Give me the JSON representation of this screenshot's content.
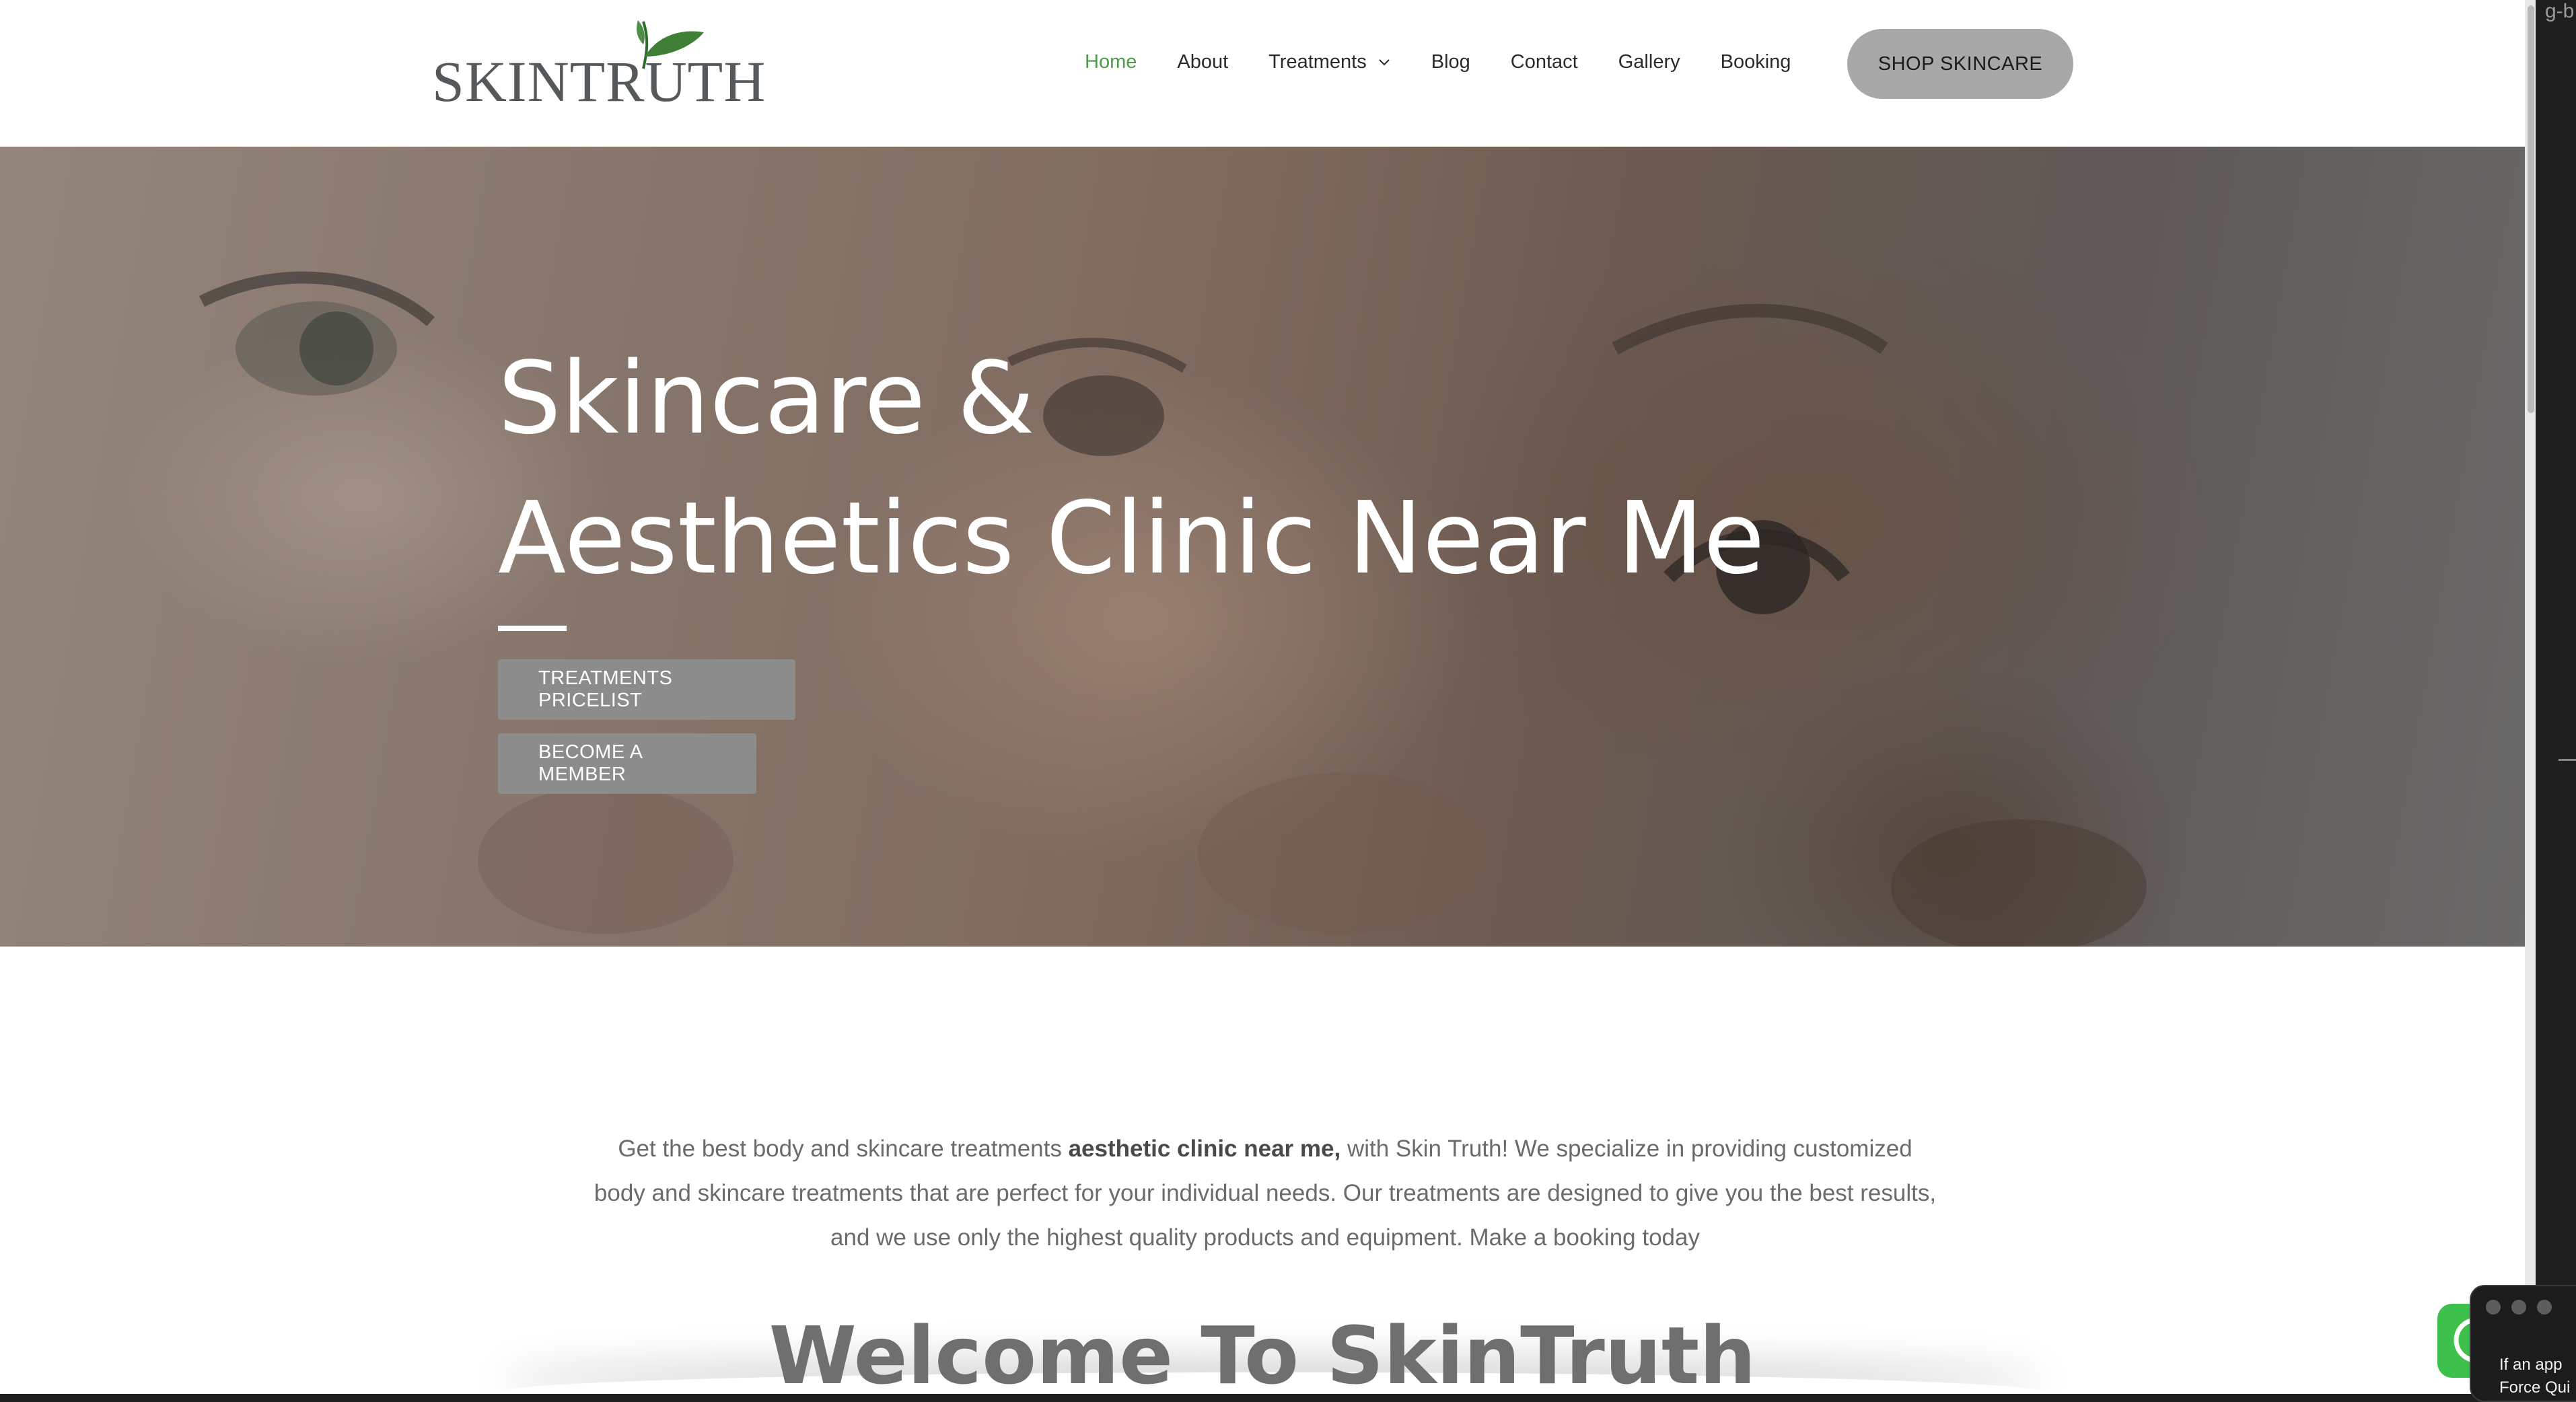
{
  "header": {
    "logo_text": "SKINTRUTH",
    "nav": [
      {
        "label": "Home",
        "active": true
      },
      {
        "label": "About"
      },
      {
        "label": "Treatments",
        "has_dropdown": true
      },
      {
        "label": "Blog"
      },
      {
        "label": "Contact"
      },
      {
        "label": "Gallery"
      },
      {
        "label": "Booking"
      }
    ],
    "shop_button": "SHOP SKINCARE"
  },
  "hero": {
    "title_line1": "Skincare &",
    "title_line2": "Aesthetics Clinic Near Me",
    "button_pricelist": "TREATMENTS PRICELIST",
    "button_member": "BECOME A MEMBER"
  },
  "intro": {
    "part1": "Get the best body and skincare treatments ",
    "bold": "aesthetic clinic near me,",
    "part2": " with Skin Truth! We specialize in providing customized body and skincare treatments that are perfect for your individual needs. Our treatments are designed to give you the best results, and we use only the highest quality products and equipment. Make a booking today"
  },
  "welcome_heading": "Welcome To SkinTruth",
  "side": {
    "top_text": "g-b",
    "popup_line1": "If an app",
    "popup_line2": "Force Qui"
  },
  "colors": {
    "active_nav": "#4c9a4a",
    "shop_button_bg": "#a8a8a8",
    "hero_button_bg": "#8c8c8c",
    "whatsapp_green": "#3ec14c"
  },
  "icons": {
    "treatments_dropdown": "chevron-down-icon",
    "logo_leaf": "leaf-icon",
    "chat": "whatsapp-icon"
  }
}
